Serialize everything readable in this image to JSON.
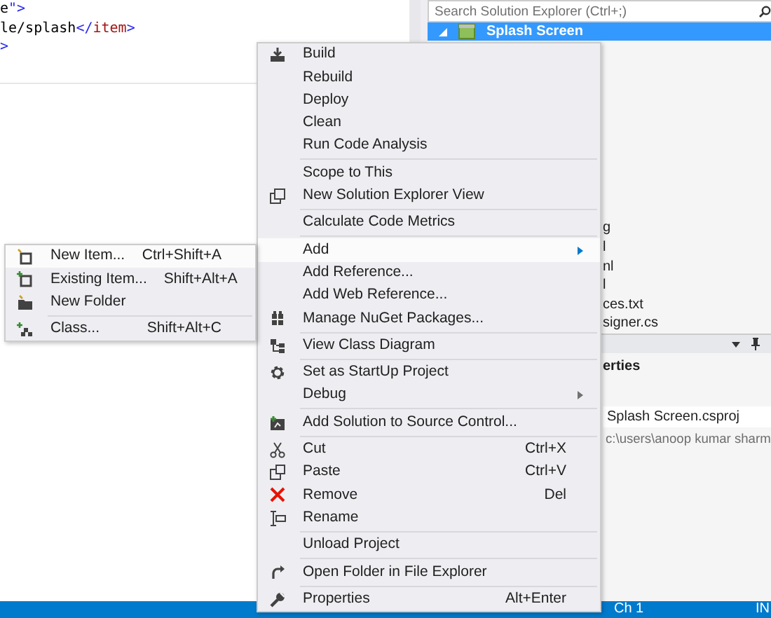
{
  "editor": {
    "code_lines": [
      [
        {
          "text": "e",
          "kind": "plain"
        },
        {
          "text": "\">",
          "kind": "punct"
        }
      ],
      [
        {
          "text": "le/splash",
          "kind": "plain"
        },
        {
          "text": "</",
          "kind": "punct"
        },
        {
          "text": "item",
          "kind": "tag"
        },
        {
          "text": ">",
          "kind": "punct"
        }
      ],
      [
        {
          "text": ">",
          "kind": "punct"
        }
      ]
    ]
  },
  "solution_explorer": {
    "search": {
      "placeholder": "Search Solution Explorer (Ctrl+;)"
    },
    "project": {
      "label": "Splash Screen",
      "selected": true,
      "expanded": true
    },
    "items": [
      "g",
      "l",
      "nl",
      "l",
      "ces.txt",
      "signer.cs"
    ]
  },
  "properties": {
    "title": "erties",
    "file_name": "Splash Screen.csproj",
    "path": "c:\\users\\anoop kumar sharm"
  },
  "context_menu": [
    {
      "label": "Build",
      "selected": false
    },
    {
      "label": "Rebuild",
      "selected": false
    },
    {
      "label": "Deploy",
      "selected": false
    },
    {
      "label": "Clean",
      "selected": false
    },
    {
      "label": "Run Code Analysis",
      "selected": false,
      "separator_after": true
    },
    {
      "label": "Scope to This",
      "selected": false
    },
    {
      "label": "New Solution Explorer View",
      "selected": false,
      "separator_after": true
    },
    {
      "label": "Calculate Code Metrics",
      "selected": false,
      "separator_after": true
    },
    {
      "label": "Add",
      "selected": true,
      "submenu": true
    },
    {
      "label": "Add Reference...",
      "selected": false
    },
    {
      "label": "Add Web Reference...",
      "selected": false
    },
    {
      "label": "Manage NuGet Packages...",
      "selected": false,
      "separator_after": true
    },
    {
      "label": "View Class Diagram",
      "selected": false,
      "separator_after": true
    },
    {
      "label": "Set as StartUp Project",
      "selected": false
    },
    {
      "label": "Debug",
      "selected": false,
      "submenu": true,
      "separator_after": true
    },
    {
      "label": "Add Solution to Source Control...",
      "selected": false,
      "separator_after": true
    },
    {
      "label": "Cut",
      "selected": false,
      "shortcut": "Ctrl+X"
    },
    {
      "label": "Paste",
      "selected": false,
      "shortcut": "Ctrl+V"
    },
    {
      "label": "Remove",
      "selected": false,
      "shortcut": "Del"
    },
    {
      "label": "Rename",
      "selected": false,
      "separator_after": true
    },
    {
      "label": "Unload Project",
      "selected": false,
      "separator_after": true
    },
    {
      "label": "Open Folder in File Explorer",
      "selected": false,
      "separator_after": true
    },
    {
      "label": "Properties",
      "selected": false,
      "shortcut": "Alt+Enter"
    }
  ],
  "add_submenu": [
    {
      "label": "New Item...",
      "selected": true,
      "shortcut": "Ctrl+Shift+A"
    },
    {
      "label": "Existing Item...",
      "selected": false,
      "shortcut": "Shift+Alt+A"
    },
    {
      "label": "New Folder",
      "selected": false,
      "separator_after": true
    },
    {
      "label": "Class...",
      "selected": false,
      "shortcut": "Shift+Alt+C"
    }
  ],
  "status_bar": {
    "column": "Ch 1",
    "mode": "IN"
  }
}
